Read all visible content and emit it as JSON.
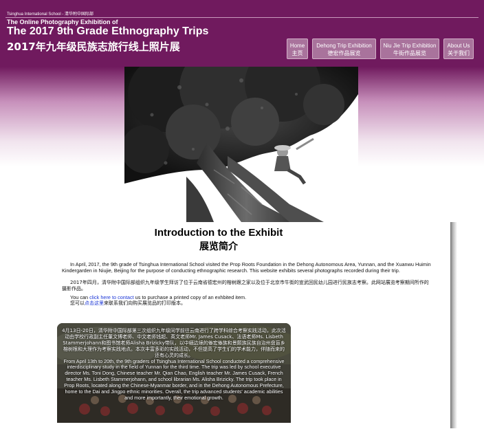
{
  "header": {
    "school": "Tsinghua International School - 清华附中国际部",
    "subtitle": "The Online Photography Exhibition of",
    "title_en": "The 2017 9th Grade Ethnography Trips",
    "title_zh": "2017年九年级民族志旅行线上照片展"
  },
  "nav": [
    {
      "en": "Home",
      "zh": "主页"
    },
    {
      "en": "Dehong Trip Exhibition",
      "zh": "德宏作品展览"
    },
    {
      "en": "Niu Jie Trip Exhibition",
      "zh": "牛街作品展览"
    },
    {
      "en": "About Us",
      "zh": "关于我们"
    }
  ],
  "intro": {
    "title_en": "Introduction to the Exhibit",
    "title_zh": "展览简介",
    "para_en": "In April, 2017, the 9th grade of Tsinghua International School visited the Prop Roots Foundation in the Dehong Autonomous Area, Yunnan, and the Xuanwu Huimin Kindergarden in Niujie, Beijing for the purpose of conducting ethnographic research. This website exhibits several photographs recorded during their trip.",
    "para_zh": "2017年四月，清华附中国际部组织九年级学生拜访了位于云南省德宏州的榕树跟之家以及位于北京市牛街的宣武回民幼儿园进行民族志考察。此网站展览考察期间所作的摄影作品。",
    "contact_pre": "You can ",
    "contact_link": "click here to contact",
    "contact_post": " us to purchase a printed copy of an exhbited item.",
    "contact_zh_pre": "您可以",
    "contact_zh_link": "点击这里",
    "contact_zh_post": "来联系我们向购买展览品的打印版本。"
  },
  "box": {
    "text_zh": "4月13日-20日，清华附中国际部第三次组织九年级同学前往云南进行了跨学科综合考察实践活动，此次活动由学校行政副主任董文博老师、中文老师钱超、英文老师Mr. James Cusack、法语老师Ms. Lisbeth Stammerjohann和图书馆老师Alisha Brizicky带队，以中缅边境的傣宏傣族和景颇族民族自治州盘盲乡榕树根和大理作为考察实践地点。本次丰富多彩的实践活动，不但提高了学生们的学术能力，伴随而来的还有心灵的成长。",
    "text_en": "From April 13th to 20th, the 9th graders of Tsinghua International School conducted a comprehensive interdisciplinary study in the field of Yunnan for the third time. The trip was led by school executive director Ms. Toni Dong, Chinese teacher Mr. Qian Chao, English teacher Mr. James Cusack, French teacher Ms. Lisbeth Stammerjohann, and school librarian Ms. Alisha Brizicky. The trip took place in Prop Roots, located along the Chinese-Myanmar border, and in the Dehong Autonomous Prefecture, home to the Dai and Jingpo ethnic minorities. Overall, the trip advanced students' academic abilities and more importantly, their emotional growth."
  }
}
